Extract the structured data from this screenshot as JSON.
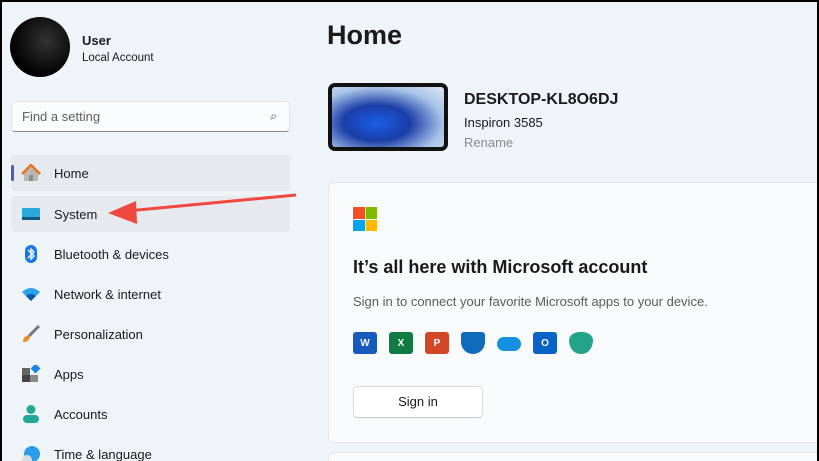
{
  "user": {
    "name": "User",
    "type": "Local Account"
  },
  "search": {
    "placeholder": "Find a setting"
  },
  "nav": [
    {
      "label": "Home",
      "icon": "home-icon"
    },
    {
      "label": "System",
      "icon": "monitor-icon"
    },
    {
      "label": "Bluetooth & devices",
      "icon": "bluetooth-icon"
    },
    {
      "label": "Network & internet",
      "icon": "wifi-icon"
    },
    {
      "label": "Personalization",
      "icon": "brush-icon"
    },
    {
      "label": "Apps",
      "icon": "apps-icon"
    },
    {
      "label": "Accounts",
      "icon": "person-icon"
    },
    {
      "label": "Time & language",
      "icon": "globe-clock-icon"
    }
  ],
  "main": {
    "title": "Home",
    "device": {
      "name": "DESKTOP-KL8O6DJ",
      "model": "Inspiron 3585",
      "rename": "Rename"
    },
    "card": {
      "heading": "It’s all here with Microsoft account",
      "subtitle": "Sign in to connect your favorite Microsoft apps to your device.",
      "apps": [
        {
          "name": "word-icon",
          "letter": "W",
          "color": "#185abd"
        },
        {
          "name": "excel-icon",
          "letter": "X",
          "color": "#107c41"
        },
        {
          "name": "powerpoint-icon",
          "letter": "P",
          "color": "#d24726"
        },
        {
          "name": "defender-icon",
          "letter": "",
          "color": "#0f6cbd"
        },
        {
          "name": "onedrive-icon",
          "letter": "",
          "color": "#1490df"
        },
        {
          "name": "outlook-icon",
          "letter": "O",
          "color": "#0a64c8"
        },
        {
          "name": "family-icon",
          "letter": "",
          "color": "#22a38a"
        }
      ],
      "signin": "Sign in"
    }
  },
  "colors": {
    "accent": "#4a5ec0",
    "annotation_arrow": "#f0473e"
  }
}
